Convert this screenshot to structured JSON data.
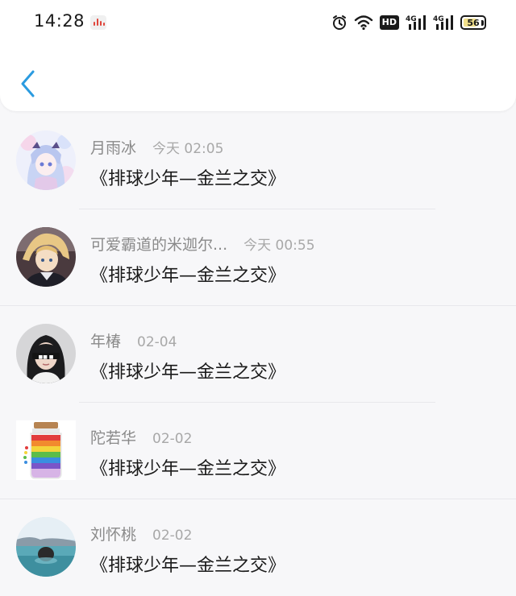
{
  "status_bar": {
    "time": "14:28",
    "battery_level": "56",
    "network_label": "4G",
    "hd_label": "HD"
  },
  "header": {
    "back_icon": "chevron-left-icon",
    "accent_color": "#2b9be0"
  },
  "items": [
    {
      "name": "月雨冰",
      "time": "今天 02:05",
      "message": "《排球少年—金兰之交》",
      "avatar": "anime-girl-avatar"
    },
    {
      "name": "可爱霸道的米迦尔...",
      "time": "今天 00:55",
      "message": "《排球少年—金兰之交》",
      "avatar": "anime-boy-avatar"
    },
    {
      "name": "年椿",
      "time": "02-04",
      "message": "《排球少年—金兰之交》",
      "avatar": "girl-photo-avatar"
    },
    {
      "name": "陀若华",
      "time": "02-02",
      "message": "《排球少年—金兰之交》",
      "avatar": "rainbow-jar-avatar"
    },
    {
      "name": "刘怀桃",
      "time": "02-02",
      "message": "《排球少年—金兰之交》",
      "avatar": "lake-photo-avatar"
    }
  ]
}
